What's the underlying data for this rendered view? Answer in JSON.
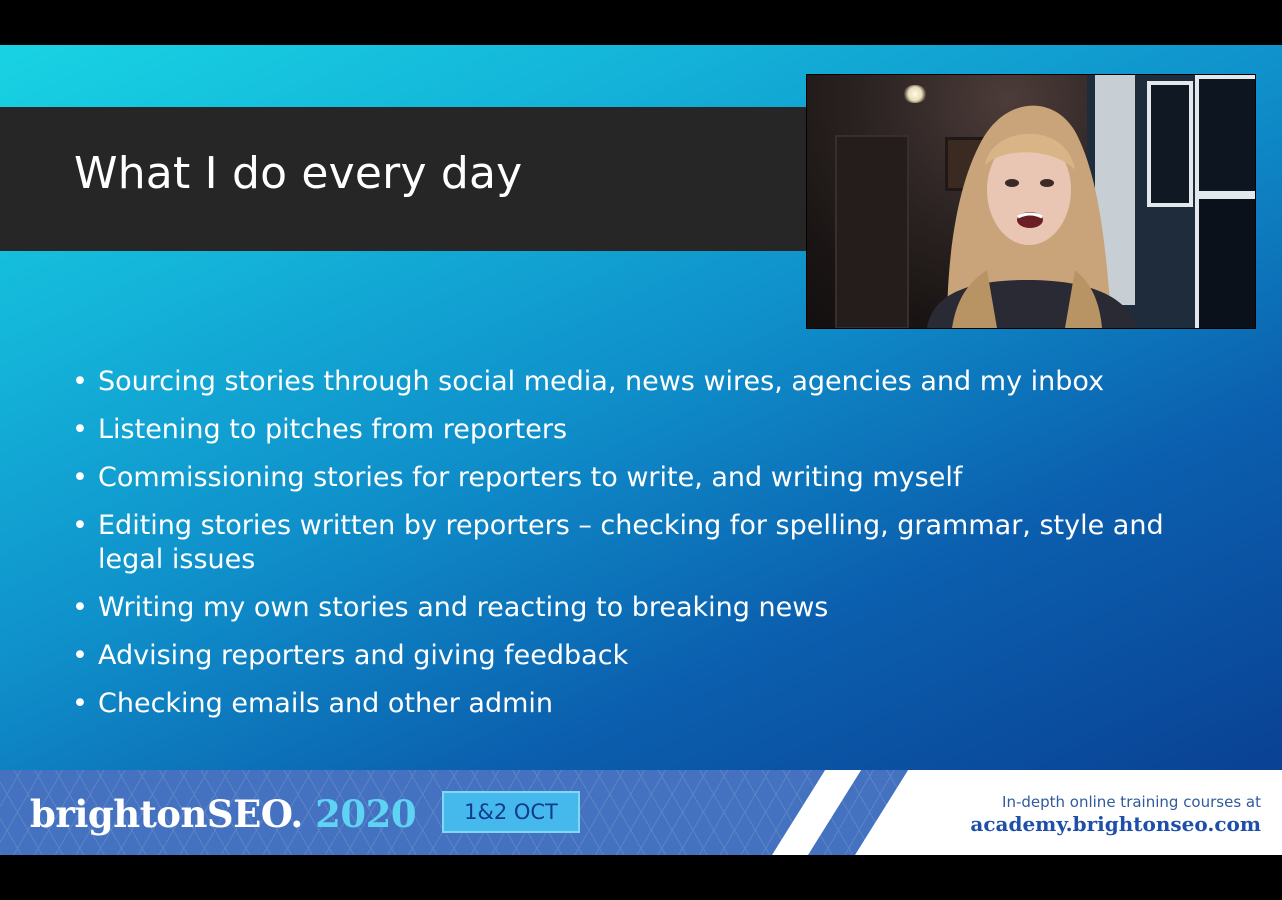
{
  "slide": {
    "title": "What I do every day",
    "bullets": [
      "Sourcing stories through social media, news wires, agencies and my inbox",
      "Listening to pitches from reporters",
      "Commissioning stories for reporters to write, and writing myself",
      "Editing stories written by reporters – checking for spelling, grammar, style and legal issues",
      "Writing my own stories and reacting to breaking news",
      "Advising reporters and giving feedback",
      "Checking emails and other admin"
    ],
    "bullet_glyph": "•"
  },
  "footer": {
    "brand_name": "brightonSEO.",
    "brand_year": " 2020",
    "date_badge": "1&2 OCT",
    "promo_line1": "In-depth online training courses at",
    "promo_line2": "academy.brightonseo.com"
  },
  "colors": {
    "title_bar": "#262626",
    "footer_blue": "#4472c0",
    "accent_cyan": "#5fd3f3"
  }
}
